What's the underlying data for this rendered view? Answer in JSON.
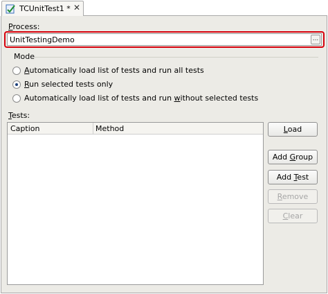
{
  "tab": {
    "label": "TCUnitTest1 *",
    "close_glyph": "✕",
    "icon": "unit-test-icon"
  },
  "process": {
    "label_prefix": "",
    "label_accel": "P",
    "label_rest": "rocess:",
    "value": "UnitTestingDemo",
    "browse_label": "...",
    "highlight_color": "#d6000c"
  },
  "mode": {
    "title": "Mode",
    "options": [
      {
        "pre": "",
        "accel": "A",
        "post": "utomatically load list of tests and run all tests",
        "checked": false
      },
      {
        "pre": "",
        "accel": "R",
        "post": "un selected tests only",
        "checked": true
      },
      {
        "pre": "Automatically load list of tests and run ",
        "accel": "w",
        "post": "ithout selected tests",
        "checked": false
      }
    ]
  },
  "tests": {
    "label_accel": "T",
    "label_rest": "ests:",
    "columns": [
      "Caption",
      "Method"
    ],
    "rows": []
  },
  "buttons": {
    "load": {
      "pre": "",
      "accel": "L",
      "post": "oad"
    },
    "add_group": {
      "pre": "Add ",
      "accel": "G",
      "post": "roup"
    },
    "add_test": {
      "pre": "Add ",
      "accel": "T",
      "post": "est"
    },
    "remove": {
      "pre": "",
      "accel": "R",
      "post": "emove"
    },
    "clear": {
      "pre": "",
      "accel": "C",
      "post": "lear"
    }
  },
  "colors": {
    "panel_bg": "#ecebe6",
    "border": "#9a9a9a",
    "radio_dot": "#1b3f7a"
  }
}
